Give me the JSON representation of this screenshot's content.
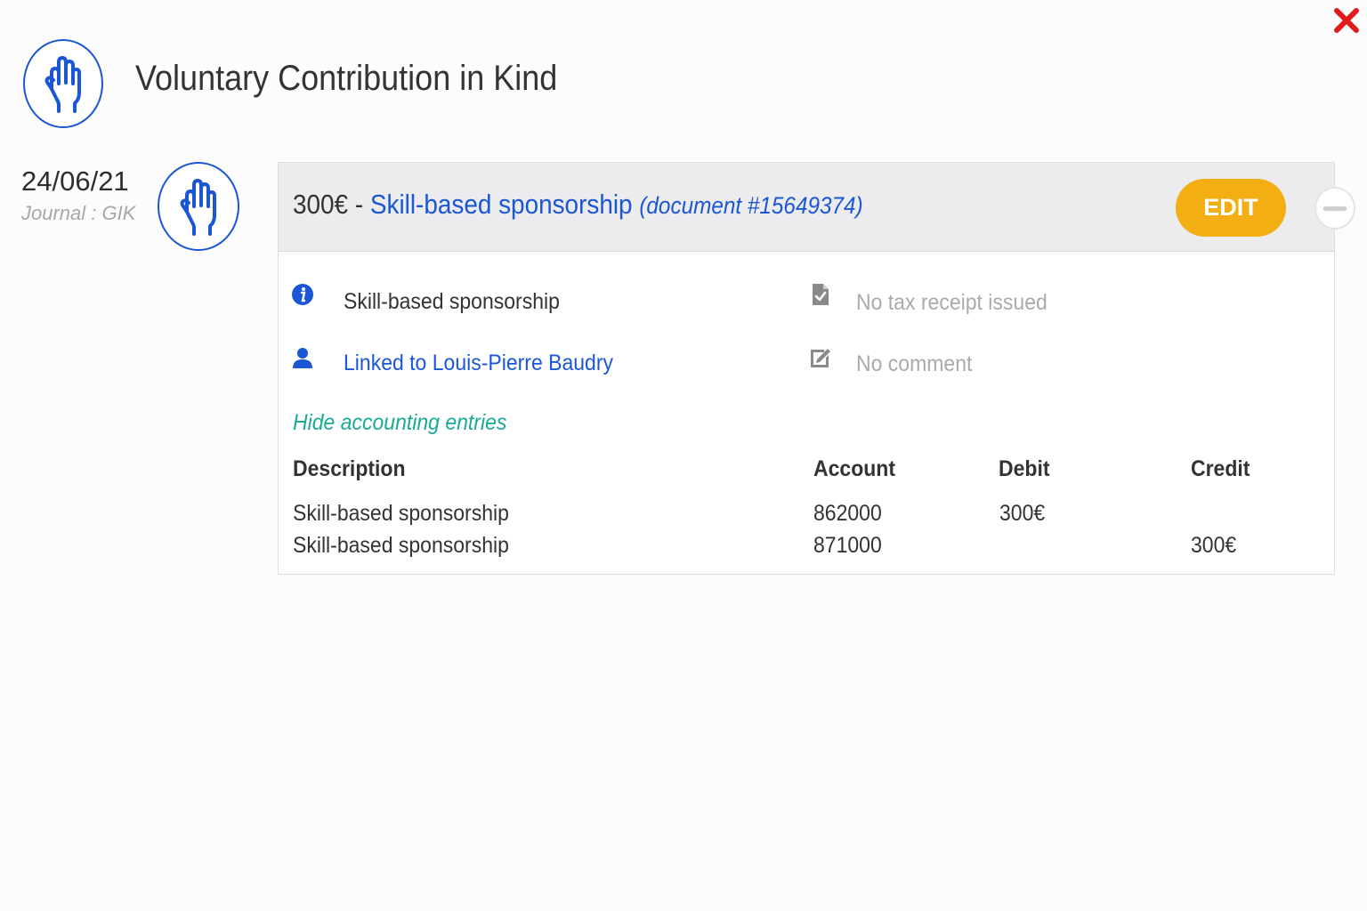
{
  "header": {
    "title": "Voluntary Contribution in Kind",
    "icon": "hand-icon",
    "close_icon": "close-icon",
    "accent_color": "#1b57d4",
    "close_color": "#e11b1b"
  },
  "entry": {
    "date": "24/06/21",
    "journal": "Journal : GIK",
    "icon": "hand-icon",
    "amount": "300€",
    "separator": "-",
    "type": "Skill-based sponsorship",
    "document": "(document #15649374)",
    "edit_label": "EDIT",
    "edit_color": "#f3ae14"
  },
  "details": {
    "category": "Skill-based sponsorship",
    "linked": "Linked to Louis-Pierre Baudry",
    "tax_receipt": "No tax receipt issued",
    "comment": "No comment",
    "toggle_label": "Hide accounting entries"
  },
  "accounting": {
    "columns": [
      "Description",
      "Account",
      "Debit",
      "Credit"
    ],
    "rows": [
      {
        "description": "Skill-based sponsorship",
        "account": "862000",
        "debit": "300€",
        "credit": ""
      },
      {
        "description": "Skill-based sponsorship",
        "account": "871000",
        "debit": "",
        "credit": "300€"
      }
    ]
  }
}
